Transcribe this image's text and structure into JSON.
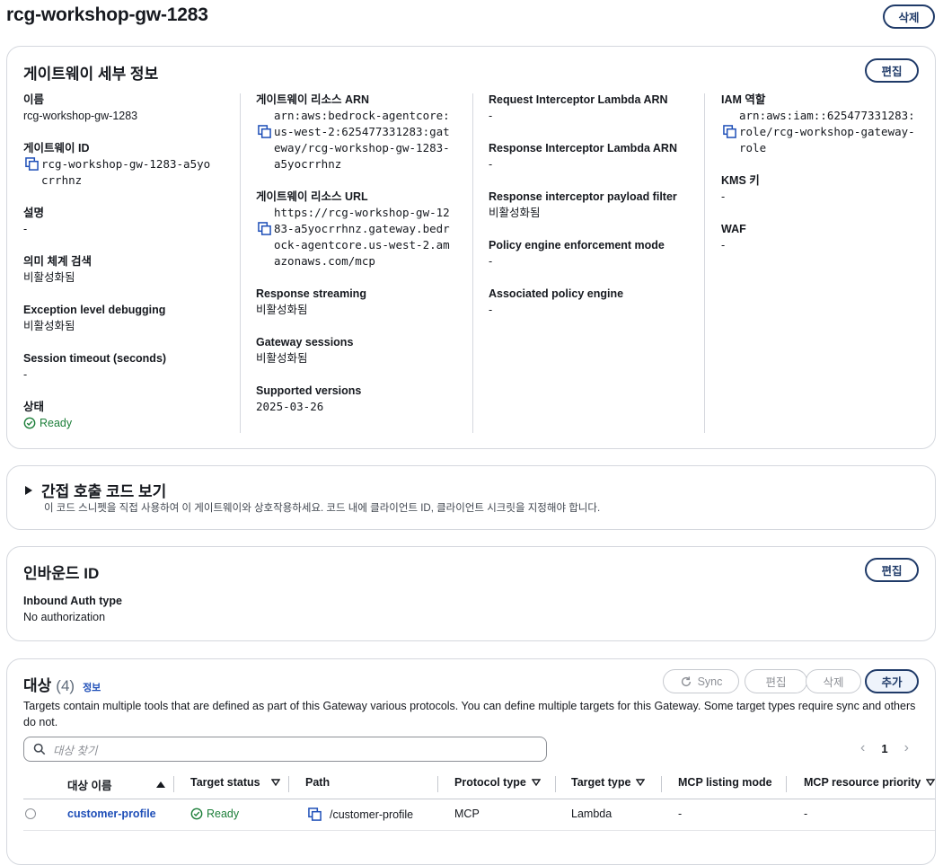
{
  "header": {
    "title": "rcg-workshop-gw-1283",
    "delete_label": "삭제"
  },
  "details": {
    "title": "게이트웨이 세부 정보",
    "edit_label": "편집",
    "col1": [
      {
        "label": "이름",
        "value": "rcg-workshop-gw-1283"
      },
      {
        "label": "게이트웨이 ID",
        "value_lines": [
          "rcg-workshop-gw-1283-a5yo",
          "crrhnz"
        ]
      },
      {
        "label": "설명",
        "value": "-"
      },
      {
        "label": "의미 체계 검색",
        "value": "비활성화됨"
      },
      {
        "label": "Exception level debugging",
        "value": "비활성화됨"
      },
      {
        "label": "Session timeout (seconds)",
        "value": "-"
      },
      {
        "label": "상태",
        "value": "Ready"
      }
    ],
    "col2": [
      {
        "label": "게이트웨이 리소스 ARN",
        "value_lines": [
          "arn:aws:bedrock-agentcore:",
          "us-west-2:625477331283:gat",
          "eway/rcg-workshop-gw-1283-",
          "a5yocrrhnz"
        ]
      },
      {
        "label": "게이트웨이 리소스 URL",
        "value_lines": [
          "https://rcg-workshop-gw-12",
          "83-a5yocrrhnz.gateway.bedr",
          "ock-agentcore.us-west-2.am",
          "azonaws.com/mcp"
        ]
      },
      {
        "label": "Response streaming",
        "value": "비활성화됨"
      },
      {
        "label": "Gateway sessions",
        "value": "비활성화됨"
      },
      {
        "label": "Supported versions",
        "value": "2025-03-26"
      }
    ],
    "col3": [
      {
        "label": "Request Interceptor Lambda ARN",
        "value": "-"
      },
      {
        "label": "Response Interceptor Lambda ARN",
        "value": "-"
      },
      {
        "label": "Response interceptor payload filter",
        "value": "비활성화됨"
      },
      {
        "label": "Policy engine enforcement mode",
        "value": "-"
      },
      {
        "label": "Associated policy engine",
        "value": "-"
      }
    ],
    "col4": [
      {
        "label": "IAM 역할",
        "value_lines": [
          "arn:aws:iam::625477331283:",
          "role/rcg-workshop-gateway-",
          "role"
        ]
      },
      {
        "label": "KMS 키",
        "value": "-"
      },
      {
        "label": "WAF",
        "value": "-"
      }
    ]
  },
  "code": {
    "title": "간접 호출 코드 보기",
    "description": "이 코드 스니펫을 직접 사용하여 이 게이트웨이와 상호작용하세요. 코드 내에 클라이언트 ID, 클라이언트 시크릿을 지정해야 합니다."
  },
  "inbound": {
    "title": "인바운드 ID",
    "edit_label": "편집",
    "auth_label": "Inbound Auth type",
    "auth_value": "No authorization"
  },
  "targets": {
    "title": "대상",
    "count": "(4)",
    "info_label": "정보",
    "sync_label": "Sync",
    "edit_label": "편집",
    "delete_label": "삭제",
    "add_label": "추가",
    "description": "Targets contain multiple tools that are defined as part of this Gateway various protocols. You can define multiple targets for this Gateway. Some target types require sync and others do not.",
    "search_placeholder": "대상 찾기",
    "page_number": "1",
    "columns": [
      "대상 이름",
      "Target status",
      "Path",
      "Protocol type",
      "Target type",
      "MCP listing mode",
      "MCP resource priority"
    ],
    "rows": [
      {
        "name": "customer-profile",
        "status": "Ready",
        "path": "/customer-profile",
        "protocol": "MCP",
        "type": "Lambda",
        "listing": "-",
        "priority": "-"
      }
    ]
  }
}
